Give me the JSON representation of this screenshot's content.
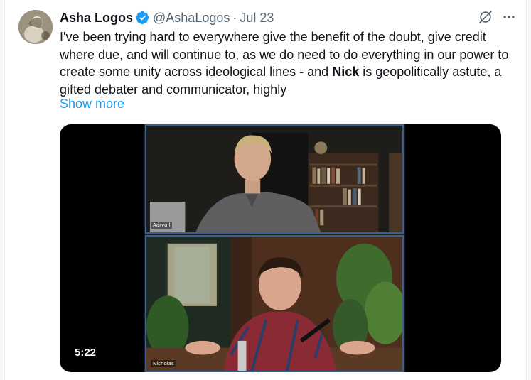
{
  "tweet": {
    "author_name": "Asha Logos",
    "handle": "@AshaLogos",
    "separator": "·",
    "date": "Jul 23",
    "text_before_bold": "I've been trying hard to everywhere give the benefit of the doubt, give credit where due, and will continue to, as we do need to do everything in our power to create some unity across ideological lines - and ",
    "text_bold": "Nick",
    "text_after_bold": " is geopolitically astute, a gifted debater and communicator, highly",
    "show_more": "Show more"
  },
  "media": {
    "duration": "5:22",
    "top_participant_label": "Aarvoll",
    "bottom_participant_label": "Nicholas"
  },
  "icons": {
    "verified": "verified-badge-icon",
    "grok": "grok-icon",
    "more": "more-icon"
  },
  "colors": {
    "accent": "#1d9bf0",
    "text": "#0f1419",
    "muted": "#536471"
  }
}
